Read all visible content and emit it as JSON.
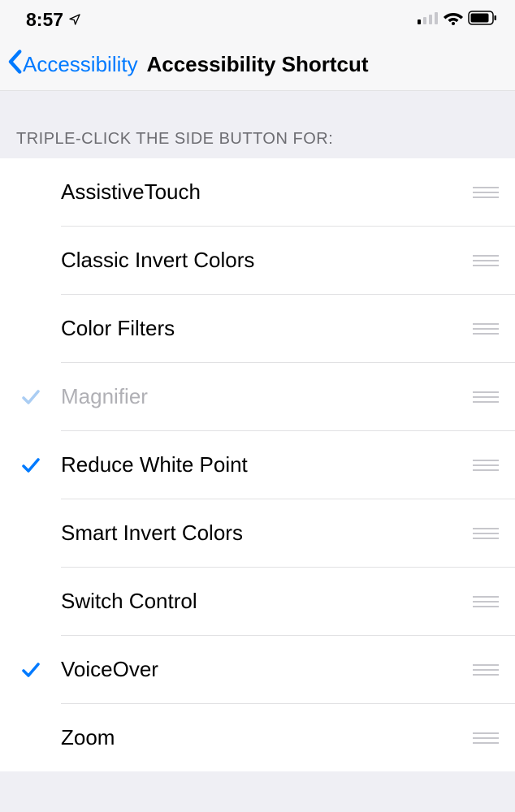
{
  "statusBar": {
    "time": "8:57"
  },
  "nav": {
    "backLabel": "Accessibility",
    "title": "Accessibility Shortcut"
  },
  "section": {
    "header": "TRIPLE-CLICK THE SIDE BUTTON FOR:"
  },
  "rows": [
    {
      "label": "AssistiveTouch",
      "checked": false,
      "disabled": false
    },
    {
      "label": "Classic Invert Colors",
      "checked": false,
      "disabled": false
    },
    {
      "label": "Color Filters",
      "checked": false,
      "disabled": false
    },
    {
      "label": "Magnifier",
      "checked": true,
      "disabled": true
    },
    {
      "label": "Reduce White Point",
      "checked": true,
      "disabled": false
    },
    {
      "label": "Smart Invert Colors",
      "checked": false,
      "disabled": false
    },
    {
      "label": "Switch Control",
      "checked": false,
      "disabled": false
    },
    {
      "label": "VoiceOver",
      "checked": true,
      "disabled": false
    },
    {
      "label": "Zoom",
      "checked": false,
      "disabled": false
    }
  ]
}
